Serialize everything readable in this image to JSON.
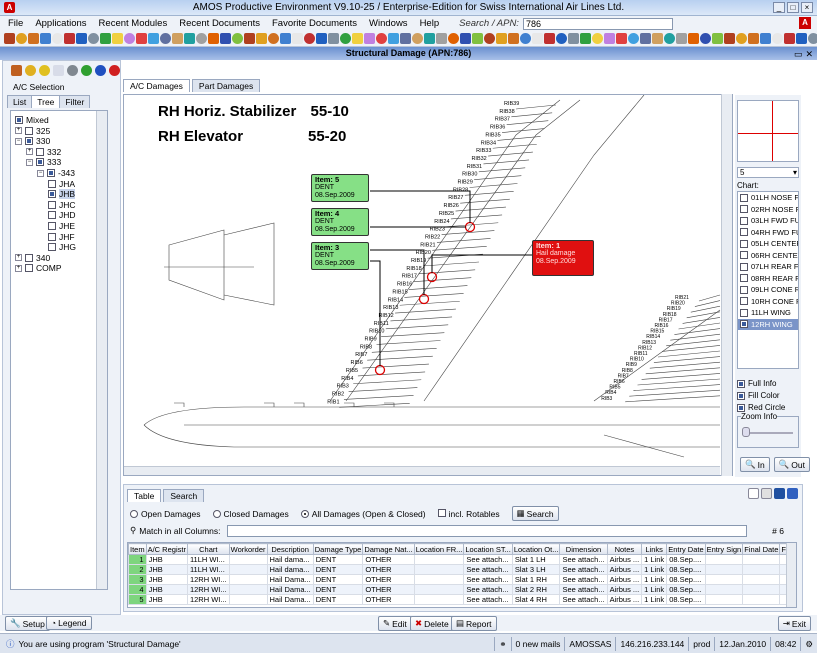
{
  "window": {
    "title": "AMOS Productive Environment V9.10-25 / Enterprise-Edition for Swiss International Air Lines Ltd."
  },
  "menu": {
    "items": [
      "File",
      "Applications",
      "Recent Modules",
      "Recent Documents",
      "Favorite Documents",
      "Windows",
      "Help"
    ],
    "search_label": "Search / APN:",
    "search_value": "786"
  },
  "module": {
    "title": "Structural Damage (APN:786)"
  },
  "left": {
    "label": "A/C Selection",
    "tabs": [
      "List",
      "Tree",
      "Filter"
    ],
    "tree": [
      {
        "label": "Mixed",
        "level": 0,
        "checked": true
      },
      {
        "label": "325",
        "level": 0,
        "checked": false
      },
      {
        "label": "330",
        "level": 0,
        "checked": true
      },
      {
        "label": "332",
        "level": 1,
        "checked": false
      },
      {
        "label": "333",
        "level": 1,
        "checked": true
      },
      {
        "label": "-343",
        "level": 2,
        "checked": true
      },
      {
        "label": "JHA",
        "level": 3,
        "checked": false
      },
      {
        "label": "JHB",
        "level": 3,
        "checked": true
      },
      {
        "label": "JHC",
        "level": 3,
        "checked": false
      },
      {
        "label": "JHD",
        "level": 3,
        "checked": false
      },
      {
        "label": "JHE",
        "level": 3,
        "checked": false
      },
      {
        "label": "JHF",
        "level": 3,
        "checked": false
      },
      {
        "label": "JHG",
        "level": 3,
        "checked": false
      },
      {
        "label": "340",
        "level": 0,
        "checked": false
      },
      {
        "label": "COMP",
        "level": 0,
        "checked": false
      }
    ]
  },
  "center": {
    "tabs": [
      "A/C Damages",
      "Part Damages"
    ],
    "heading1_name": "RH Horiz. Stabilizer",
    "heading1_code": "55-10",
    "heading2_name": "RH Elevator",
    "heading2_code": "55-20",
    "items": [
      {
        "title": "Item: 5",
        "type": "DENT",
        "date": "08.Sep.2009",
        "color": "#86e086"
      },
      {
        "title": "Item: 4",
        "type": "DENT",
        "date": "08.Sep.2009",
        "color": "#86e086"
      },
      {
        "title": "Item: 3",
        "type": "DENT",
        "date": "08.Sep.2009",
        "color": "#86e086"
      },
      {
        "title": "Item: 1",
        "type": "Hail damage",
        "date": "08.Sep.2009",
        "color": "#e01010"
      }
    ],
    "rib_labels_upper": [
      "RIB39",
      "RIB38",
      "RIB37",
      "RIB36",
      "RIB35",
      "RIB34",
      "RIB33",
      "RIB32",
      "RIB31",
      "RIB30",
      "RIB29",
      "RIB28",
      "RIB27",
      "RIB26",
      "RIB25",
      "RIB24",
      "RIB23",
      "RIB22",
      "RIB21",
      "RIB20",
      "RIB19",
      "RIB18",
      "RIB17",
      "RIB16",
      "RIB15",
      "RIB14",
      "RIB13",
      "RIB12",
      "RIB11",
      "RIB10",
      "RIB9",
      "RIB8",
      "RIB7",
      "RIB6",
      "RIB5",
      "RIB4",
      "RIB3",
      "RIB2",
      "RIB1"
    ],
    "rib_labels_lower": [
      "RIB21",
      "RIB20",
      "RIB19",
      "RIB18",
      "RIB17",
      "RIB16",
      "RIB15",
      "RIB14",
      "RIB13",
      "RIB12",
      "RIB11",
      "RIB10",
      "RIB9",
      "RIB8",
      "RIB7",
      "RIB6",
      "RIB5",
      "RIB4",
      "RIB3"
    ]
  },
  "right": {
    "select_value": "5",
    "chart_label": "Chart:",
    "charts": [
      "01LH NOSE FWD",
      "02RH NOSE FWD",
      "03LH FWD FUSE",
      "04RH FWD FUSE",
      "05LH CENTER F",
      "06RH CENTER F",
      "07LH REAR FUS",
      "08RH REAR FUS",
      "09LH CONE REA",
      "10RH CONE REA",
      "11LH WING",
      "12RH WING"
    ],
    "selected_chart": 11,
    "options": [
      "Full Info",
      "Fill Color",
      "Red Circle"
    ],
    "zoom_label": "Zoom Info",
    "in_label": "In",
    "out_label": "Out"
  },
  "lower": {
    "tabs": [
      "Table",
      "Search"
    ],
    "filters": [
      "Open Damages",
      "Closed Damages",
      "All Damages (Open & Closed)",
      "incl. Rotables"
    ],
    "search_btn": "Search",
    "match_label": "Match in all Columns:",
    "count": "# 6",
    "columns": [
      "Item",
      "A/C Registr",
      "Chart",
      "Workorder",
      "Description",
      "Damage Type",
      "Damage Nat...",
      "Location FR...",
      "Location ST...",
      "Location Ot...",
      "Dimension",
      "Notes",
      "Links",
      "Entry Date",
      "Entry Sign",
      "Final Date",
      "Final Sign"
    ],
    "rows": [
      [
        "1",
        "JHB",
        "11LH WI...",
        "",
        "Hail dama...",
        "DENT",
        "OTHER",
        "",
        "See attach...",
        "Slat 1 LH",
        "See attach...",
        "Airbus ...",
        "1 Link",
        "08.Sep....",
        "",
        "",
        ""
      ],
      [
        "2",
        "JHB",
        "11LH WI...",
        "",
        "Hail dama...",
        "DENT",
        "OTHER",
        "",
        "See attach...",
        "Slat 3 LH",
        "See attach...",
        "Airbus ...",
        "1 Link",
        "08.Sep....",
        "",
        "",
        ""
      ],
      [
        "3",
        "JHB",
        "12RH WI...",
        "",
        "Hail Dama...",
        "DENT",
        "OTHER",
        "",
        "See attach...",
        "Slat 1 RH",
        "See attach...",
        "Airbus ...",
        "1 Link",
        "08.Sep....",
        "",
        "",
        ""
      ],
      [
        "4",
        "JHB",
        "12RH WI...",
        "",
        "Hail Dama...",
        "DENT",
        "OTHER",
        "",
        "See attach...",
        "Slat 2 RH",
        "See attach...",
        "Airbus ...",
        "1 Link",
        "08.Sep....",
        "",
        "",
        ""
      ],
      [
        "5",
        "JHB",
        "12RH WI...",
        "",
        "Hail Dama...",
        "DENT",
        "OTHER",
        "",
        "See attach...",
        "Slat 4 RH",
        "See attach...",
        "Airbus ...",
        "1 Link",
        "08.Sep....",
        "",
        "",
        ""
      ]
    ]
  },
  "bottom": {
    "setup": "Setup",
    "legend": "Legend",
    "edit": "Edit",
    "delete": "Delete",
    "report": "Report",
    "exit": "Exit"
  },
  "status": {
    "message": "You are using program 'Structural Damage'",
    "mails": "0 new mails",
    "user": "AMOSSAS",
    "ip": "146.216.233.144",
    "env": "prod",
    "date": "12.Jan.2010",
    "time": "08:42"
  }
}
